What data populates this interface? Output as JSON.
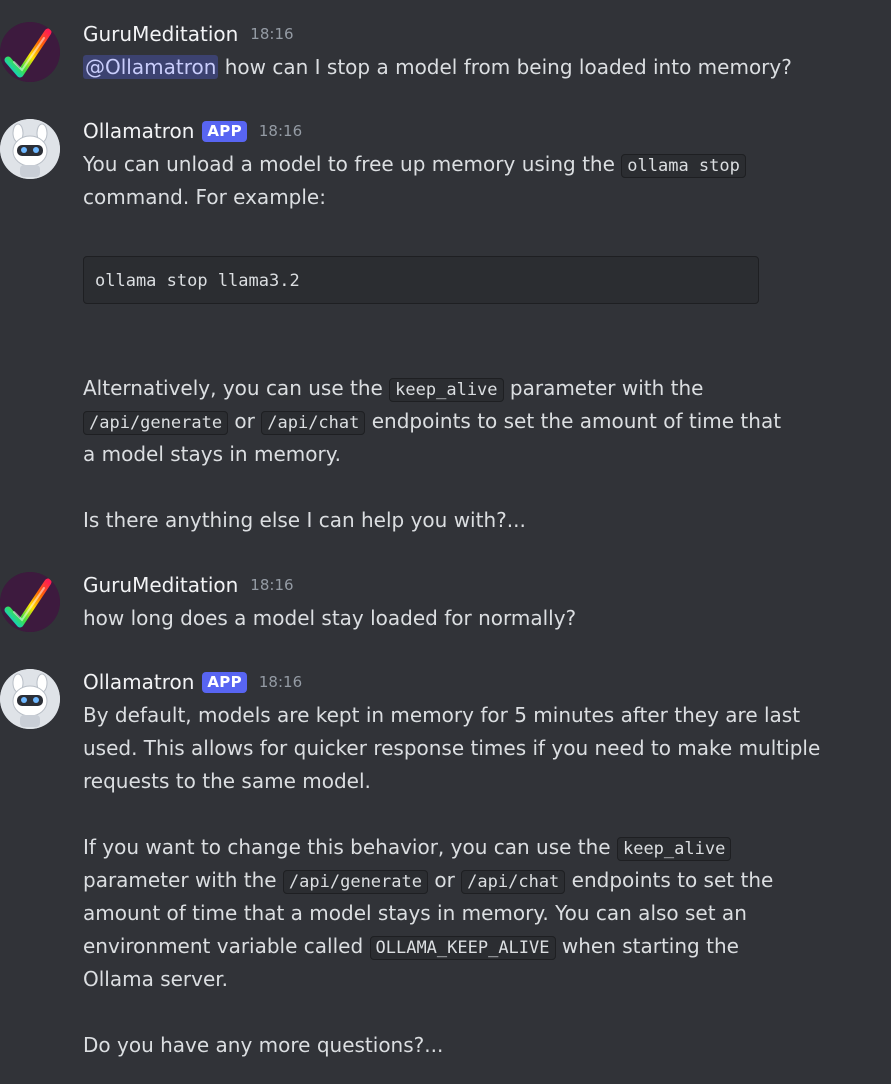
{
  "messages": [
    {
      "author": "GuruMeditation",
      "time": "18:16",
      "avatar_icon": "checkmark-rainbow-icon",
      "mention": "@Ollamatron",
      "text": " how can I stop a model from being loaded into memory?"
    },
    {
      "author": "Ollamatron",
      "badge": "APP",
      "time": "18:16",
      "avatar_icon": "robot-llama-icon",
      "l1a": "You can unload a model to free up memory using the ",
      "l1code": "ollama stop",
      "l2": "command. For example:",
      "codeblock": "ollama stop llama3.2",
      "p2a": "Alternatively, you can use the ",
      "p2code1": "keep_alive",
      "p2b": " parameter with the",
      "p2code2": "/api/generate",
      "p2c": " or ",
      "p2code3": "/api/chat",
      "p2d": " endpoints to set the amount of time that",
      "p2e": "a model stays in memory.",
      "p3": "Is there anything else I can help you with?..."
    },
    {
      "author": "GuruMeditation",
      "time": "18:16",
      "avatar_icon": "checkmark-rainbow-icon",
      "text": "how long does a model stay loaded for normally?"
    },
    {
      "author": "Ollamatron",
      "badge": "APP",
      "time": "18:16",
      "avatar_icon": "robot-llama-icon",
      "p1l1": "By default, models are kept in memory for 5 minutes after they are last",
      "p1l2": "used. This allows for quicker response times if you need to make multiple",
      "p1l3": "requests to the same model.",
      "p2l1a": "If you want to change this behavior, you can use the ",
      "p2l1code": "keep_alive",
      "p2l2a": "parameter with the ",
      "p2l2code1": "/api/generate",
      "p2l2b": " or ",
      "p2l2code2": "/api/chat",
      "p2l2c": " endpoints to set the",
      "p2l3": "amount of time that a model stays in memory. You can also set an",
      "p2l4a": "environment variable called ",
      "p2l4code": "OLLAMA_KEEP_ALIVE",
      "p2l4b": " when starting the",
      "p2l5": "Ollama server.",
      "p3": "Do you have any more questions?..."
    }
  ],
  "colors": {
    "background": "#313338",
    "app_badge": "#5865f2",
    "mention_bg": "#3c4270",
    "code_bg": "#2b2d31"
  }
}
